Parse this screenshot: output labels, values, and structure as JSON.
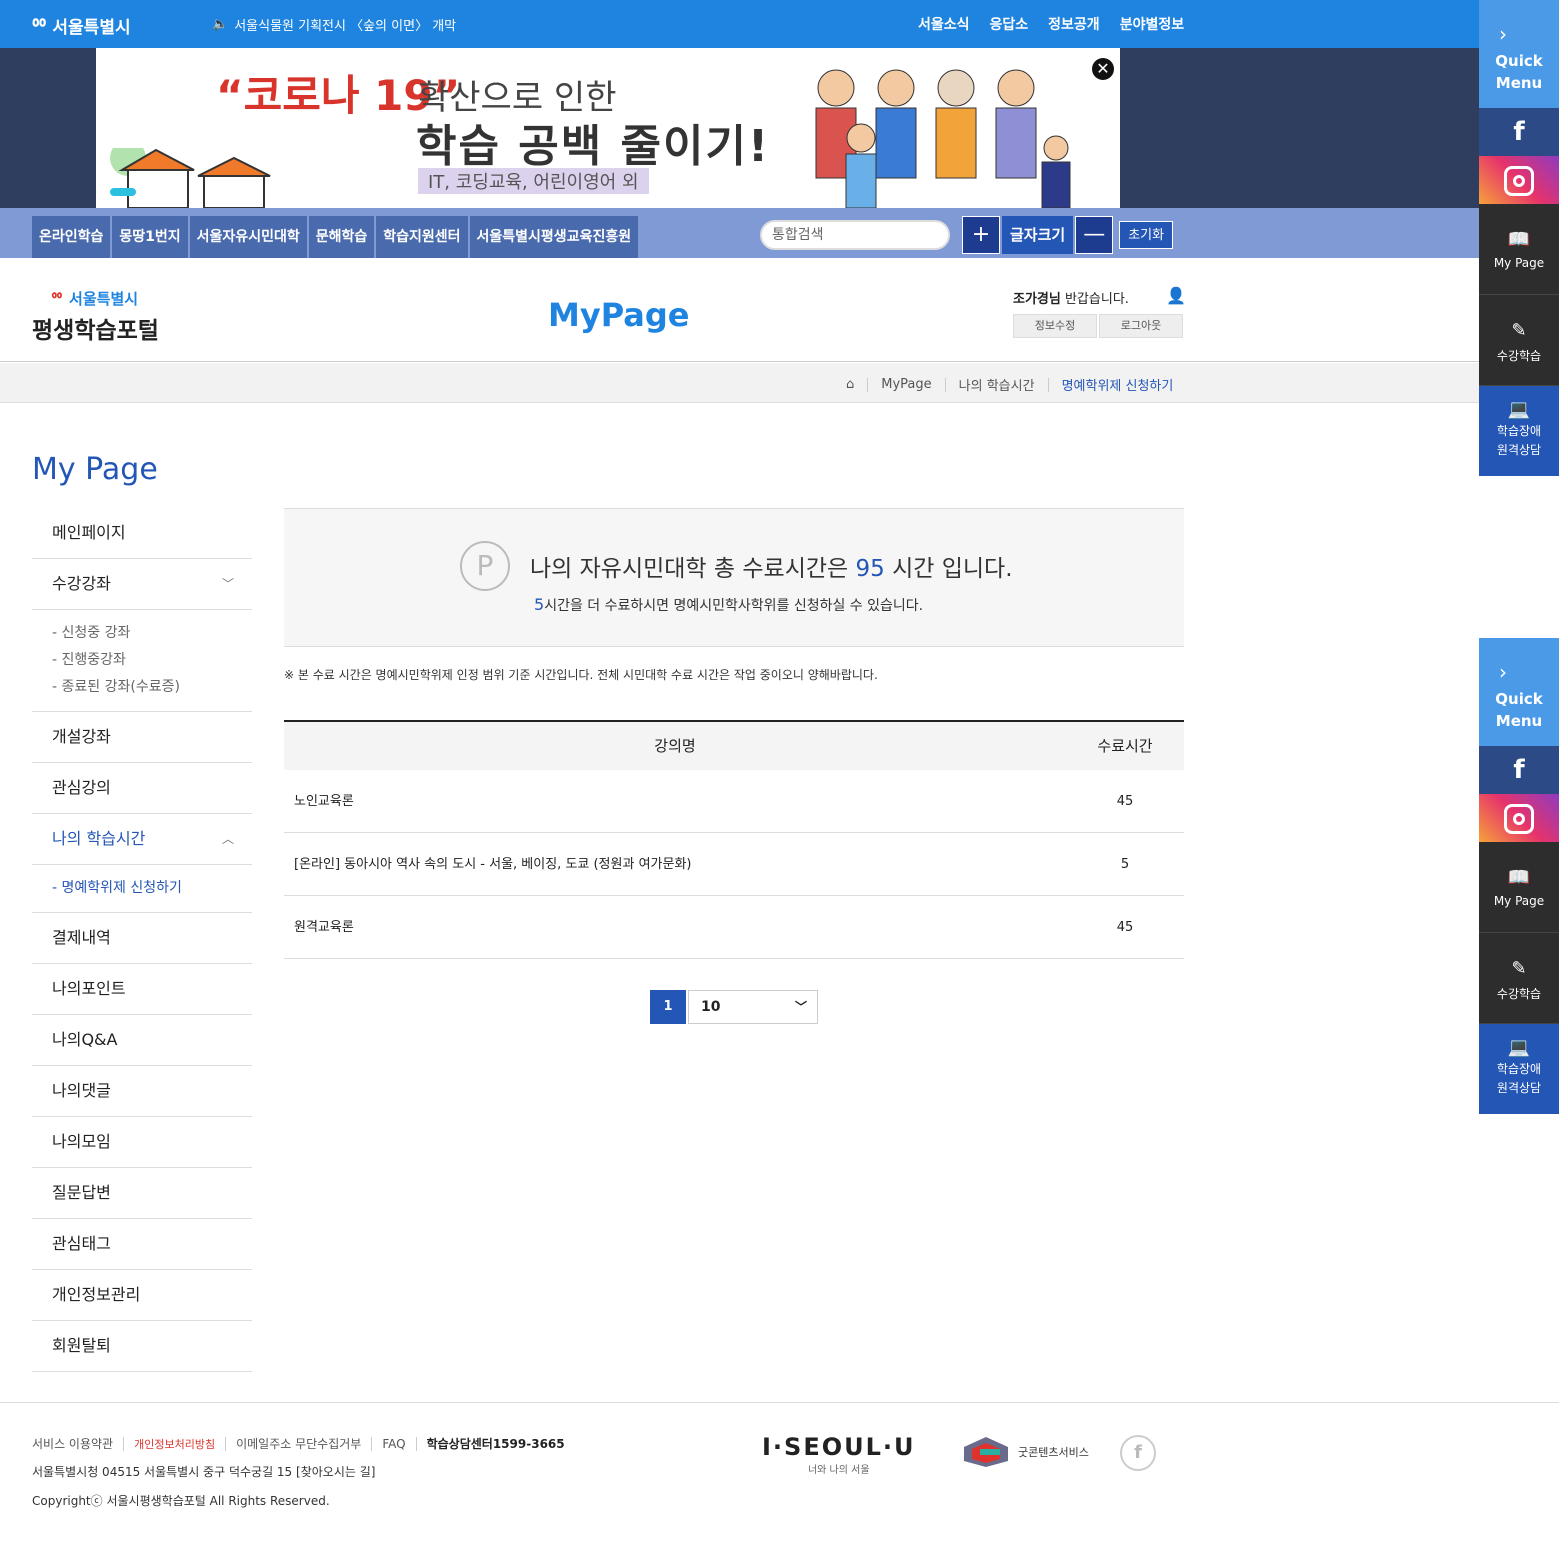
{
  "topbar": {
    "logo": "서울특별시",
    "notice": "서울식물원 기획전시 〈숲의 이면〉 개막",
    "links": [
      "서울소식",
      "응답소",
      "정보공개",
      "분야별정보"
    ]
  },
  "banner": {
    "line1": "“코로나 19”",
    "line1b": "확산으로 인한",
    "line2": "학습 공백 줄이기!",
    "line3": "IT, 코딩교육, 어린이영어 외"
  },
  "nav": {
    "tabs": [
      "온라인학습",
      "몽땅1번지",
      "서울자유시민대학",
      "문해학습",
      "학습지원센터",
      "서울특별시평생교육진흥원"
    ],
    "search_placeholder": "통합검색",
    "font_label": "글자크기",
    "reset": "초기화"
  },
  "header": {
    "logo_small": "서울특별시",
    "logo_big": "평생학습포털",
    "title": "MyPage",
    "user_name": "조가경님",
    "greeting": " 반갑습니다.",
    "btn_edit": "정보수정",
    "btn_logout": "로그아웃"
  },
  "breadcrumb": [
    "MyPage",
    "나의 학습시간",
    "명예학위제 신청하기"
  ],
  "sidebar": {
    "title": "My Page",
    "items": {
      "main": "메인페이지",
      "courses": "수강강좌",
      "courses_sub": [
        "- 신청중 강좌",
        "- 진행중강좌",
        "- 종료된 강좌(수료증)"
      ],
      "open": "개설강좌",
      "interest": "관심강의",
      "learning_time": "나의 학습시간",
      "learning_sub": "- 명예학위제 신청하기",
      "payment": "결제내역",
      "points": "나의포인트",
      "qa": "나의Q&A",
      "comments": "나의댓글",
      "groups": "나의모임",
      "answers": "질문답변",
      "tags": "관심태그",
      "privacy": "개인정보관리",
      "withdraw": "회원탈퇴"
    }
  },
  "summary": {
    "icon_letter": "P",
    "line1_pre": "나의 자유시민대학 총 수료시간은 ",
    "total_hours": "95",
    "line1_post": " 시간 입니다.",
    "remaining": "5",
    "line2_post": "시간을 더 수료하시면 명예시민학사학위를 신청하실 수 있습니다."
  },
  "note": "※ 본 수료 시간은 명예시민학위제 인정 범위 기준 시간입니다. 전체 시민대학 수료 시간은 작업 중이오니 양해바랍니다.",
  "table": {
    "headers": [
      "강의명",
      "수료시간"
    ],
    "rows": [
      {
        "name": "노인교육론",
        "hours": "45"
      },
      {
        "name": "[온라인] 동아시아 역사 속의 도시 - 서울, 베이징, 도쿄 (정원과 여가문화)",
        "hours": "5"
      },
      {
        "name": "원격교육론",
        "hours": "45"
      }
    ]
  },
  "pager": {
    "current": "1",
    "page_size": "10"
  },
  "footer": {
    "links": [
      "서비스 이용약관",
      "개인정보처리방침",
      "이메일주소 무단수집거부",
      "FAQ",
      "학습상담센터1599-3665"
    ],
    "address": "서울특별시청 04515 서울특별시 중구 덕수궁길 15 [찾아오시는 길]",
    "copyright": "Copyrightⓒ 서울시평생학습포털 All Rights Reserved.",
    "iseoul": "I·SEOUL·U",
    "iseoul_sub": "너와 나의 서울",
    "good_content": "굿콘텐츠서비스"
  },
  "quick": {
    "head": [
      "Quick",
      "Menu"
    ],
    "mypage": "My Page",
    "study": "수강학습",
    "consult": [
      "학습장애",
      "원격상담"
    ]
  }
}
